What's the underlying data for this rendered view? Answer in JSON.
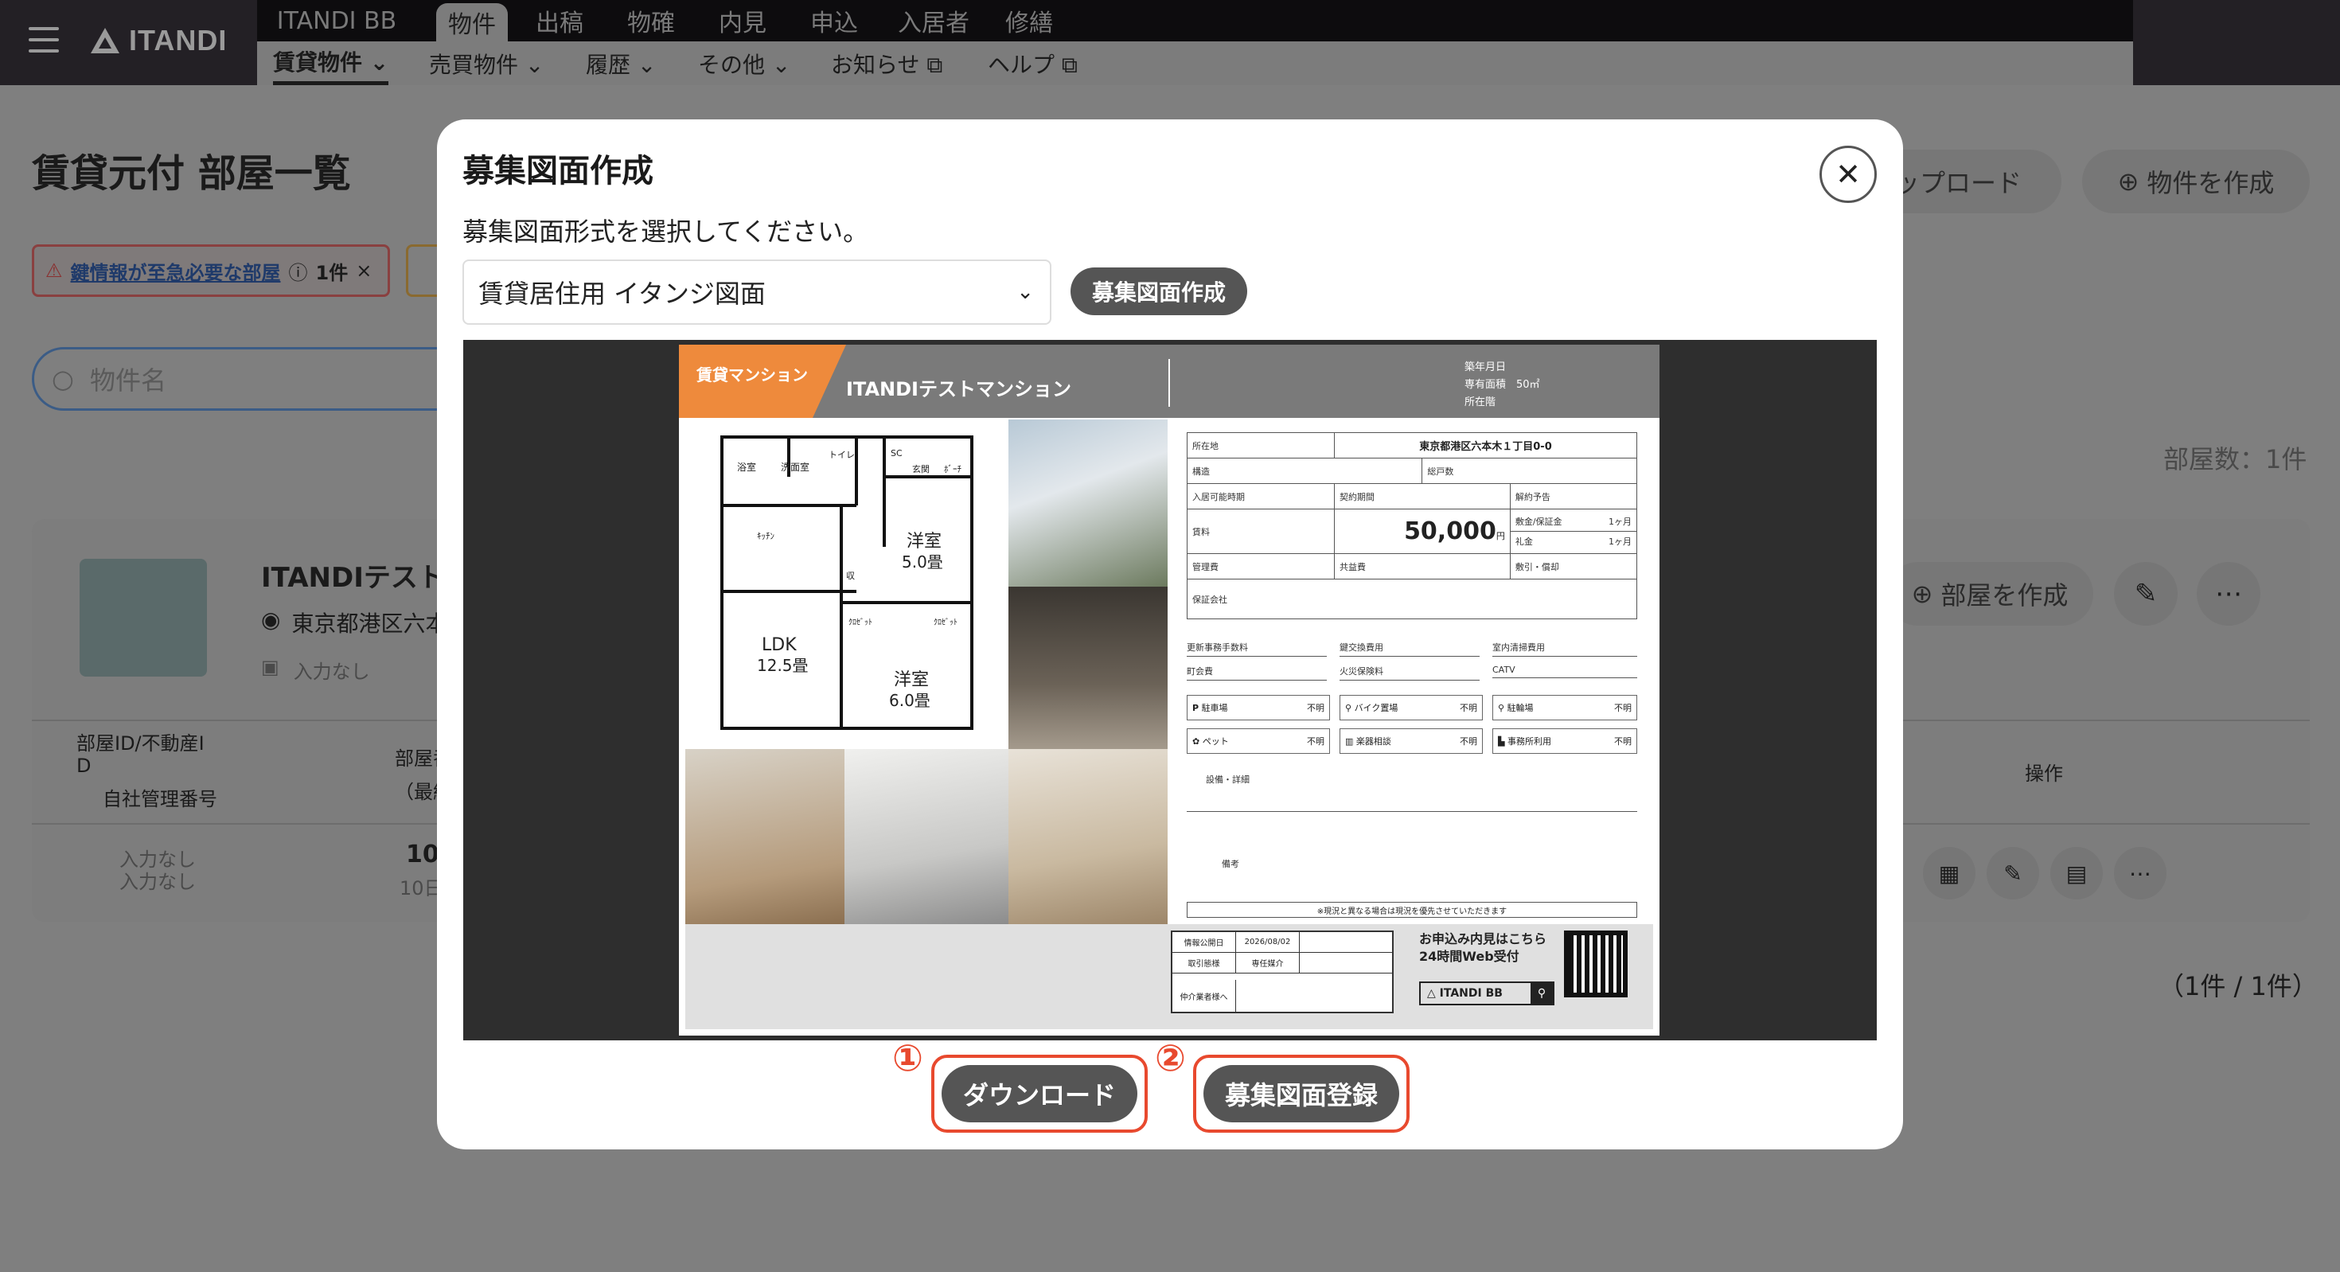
{
  "header": {
    "brand": "ITANDI",
    "top_nav": [
      "ITANDI BB",
      "物件",
      "出稿",
      "物確",
      "内見",
      "申込",
      "入居者",
      "修繕"
    ],
    "sub_nav": [
      {
        "label": "賃貸物件 ⌄"
      },
      {
        "label": "売買物件 ⌄"
      },
      {
        "label": "履歴 ⌄"
      },
      {
        "label": "その他 ⌄"
      },
      {
        "label": "お知らせ ⧉"
      },
      {
        "label": "ヘルプ ⧉"
      }
    ]
  },
  "page": {
    "title": "賃貸元付 部屋一覧",
    "upload_label": "ップロード",
    "create_property_label": "物件を作成",
    "alert_link": "鍵情報が至急必要な部屋",
    "alert_count": "1件",
    "search_placeholder": "物件名",
    "room_count": "部屋数：1件",
    "pagination": "（1件 / 1件）",
    "property": {
      "name": "ITANDIテストマ",
      "address": "東京都港区六本",
      "station": "入力なし",
      "create_room_label": "部屋を作成"
    },
    "table": {
      "col1_line1": "部屋ID/不動産I",
      "col1_line2": "D",
      "col1_line3": "自社管理番号",
      "col2_line1": "部屋番",
      "col2_line2": "（最終",
      "col_ops": "操作",
      "row_cell1": "入力なし",
      "row_cell2": "入力なし",
      "row_num": "10",
      "row_num_sub": "10日"
    }
  },
  "modal": {
    "title": "募集図面作成",
    "instruction": "募集図面形式を選択してください。",
    "selected_format": "賃貸居住用 イタンジ図面",
    "create_button": "募集図面作成",
    "download_button": "ダウンロード",
    "register_button": "募集図面登録",
    "marker1": "①",
    "marker2": "②"
  },
  "sheet": {
    "category": "賃貸マンション",
    "building_name": "ITANDIテストマンション",
    "meta_lines": [
      "築年月日",
      "専有面積　50㎡",
      "所在階"
    ],
    "address_label": "所在地",
    "address": "東京都港区六本木１丁目0-0",
    "structure": "構造",
    "units": "総戸数",
    "move_in": "入居可能時期",
    "contract": "契約期間",
    "cancel": "解約予告",
    "rent_label": "賃料",
    "rent": "50,000",
    "rent_unit": "円",
    "deposit_label": "敷金/保証金",
    "deposit": "1ヶ月",
    "key_money_label": "礼金",
    "key_money": "1ヶ月",
    "mgmt": "管理費",
    "common": "共益費",
    "amort": "敷引・償却",
    "guarantor": "保証会社",
    "fees": [
      "更新事務手数料",
      "鍵交換費用",
      "室内清掃費用",
      "町会費",
      "火災保険料",
      "CATV"
    ],
    "amenities": [
      {
        "label": "駐車場",
        "value": "不明"
      },
      {
        "label": "バイク置場",
        "value": "不明"
      },
      {
        "label": "駐輪場",
        "value": "不明"
      },
      {
        "label": "ペット",
        "value": "不明"
      },
      {
        "label": "楽器相談",
        "value": "不明"
      },
      {
        "label": "事務所利用",
        "value": "不明"
      }
    ],
    "equipment": "設備・詳細",
    "remarks": "備考",
    "notice": "※現況と異なる場合は現況を優先させていただきます",
    "info_date_label": "情報公開日",
    "info_date": "2026/08/02",
    "trade_label": "取引態様",
    "trade": "専任媒介",
    "broker_label": "仲介業者様へ",
    "apply_line1": "お申込み内見はこちら",
    "apply_line2": "24時間Web受付",
    "bb_label": "ITANDI BB",
    "floorplan": {
      "rooms": [
        "浴室",
        "洗面室",
        "トイレ",
        "SC",
        "玄関",
        "ﾎﾞｰﾁ",
        "ｷｯﾁﾝ",
        "洋室",
        "5.0畳",
        "LDK",
        "12.5畳",
        "ｸﾛｾﾞｯﾄ",
        "ｸﾛｾﾞｯﾄ",
        "洋室",
        "6.0畳",
        "収"
      ]
    }
  },
  "colors": {
    "accent": "#e8492e",
    "sheet_orange": "#ee8a3c",
    "overlay": "#7f7f7f"
  }
}
